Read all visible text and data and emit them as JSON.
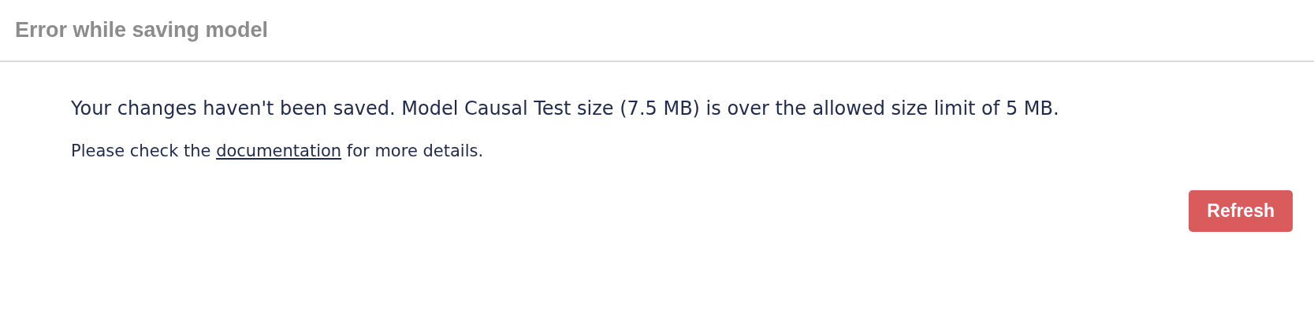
{
  "dialog": {
    "title": "Error while saving model",
    "message": "Your changes haven't been saved. Model Causal Test size (7.5 MB) is over the allowed size limit of 5 MB.",
    "detail": {
      "before": "Please check the ",
      "link": "documentation",
      "after": " for more details."
    },
    "buttons": [
      {
        "label": "Refresh",
        "kind": "primary"
      }
    ]
  }
}
